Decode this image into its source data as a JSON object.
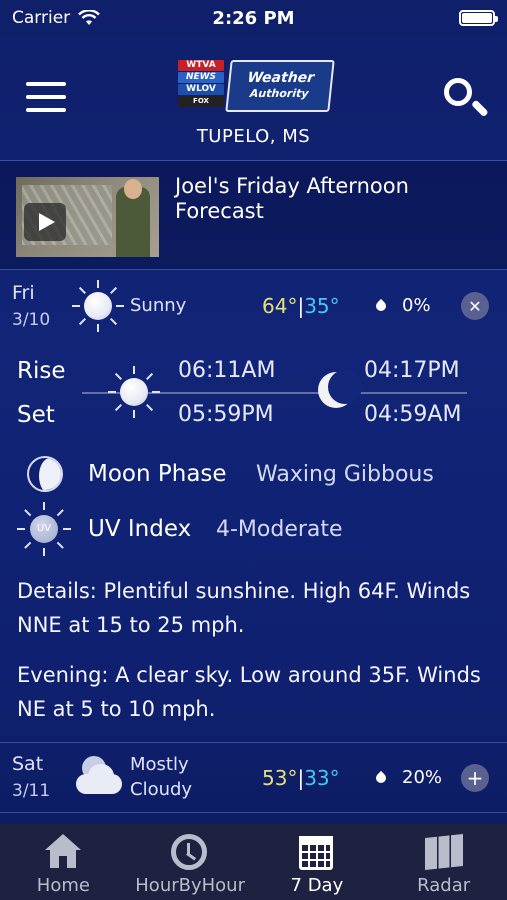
{
  "status_bar": {
    "carrier": "Carrier",
    "time": "2:26 PM",
    "battery_level": 1.0
  },
  "header": {
    "logo": {
      "line1": "WTVA",
      "line2": "NEWS",
      "line3": "WLOV",
      "line4": "FOX",
      "brand_top": "Weather",
      "brand_bottom": "Authority"
    },
    "location": "TUPELO, MS"
  },
  "video": {
    "title": "Joel's Friday Afternoon Forecast"
  },
  "today": {
    "day": "Fri",
    "date": "3/10",
    "condition": "Sunny",
    "high": "64°",
    "low": "35°",
    "separator": "|",
    "precip": "0%",
    "close_symbol": "✕",
    "rise_label": "Rise",
    "set_label": "Set",
    "sunrise": "06:11AM",
    "sunset": "05:59PM",
    "moonrise": "04:17PM",
    "moonset": "04:59AM",
    "moon_phase_label": "Moon Phase",
    "moon_phase_value": "Waxing Gibbous",
    "uv_label": "UV Index",
    "uv_value": "4-Moderate",
    "uv_icon_text": "UV",
    "details": "Details: Plentiful sunshine. High 64F. Winds NNE at 15 to 25 mph.",
    "evening": "Evening: A clear sky. Low around 35F. Winds NE at 5 to 10 mph."
  },
  "tomorrow": {
    "day": "Sat",
    "date": "3/11",
    "condition_line1": "Mostly",
    "condition_line2": "Cloudy",
    "high": "53°",
    "low": "33°",
    "separator": "|",
    "precip": "20%",
    "expand_symbol": "+"
  },
  "tabbar": {
    "tabs": [
      {
        "label": "Home",
        "icon": "home-icon"
      },
      {
        "label": "HourByHour",
        "icon": "clock-icon"
      },
      {
        "label": "7 Day",
        "icon": "calendar-icon",
        "active": true
      },
      {
        "label": "Radar",
        "icon": "map-icon"
      }
    ]
  }
}
